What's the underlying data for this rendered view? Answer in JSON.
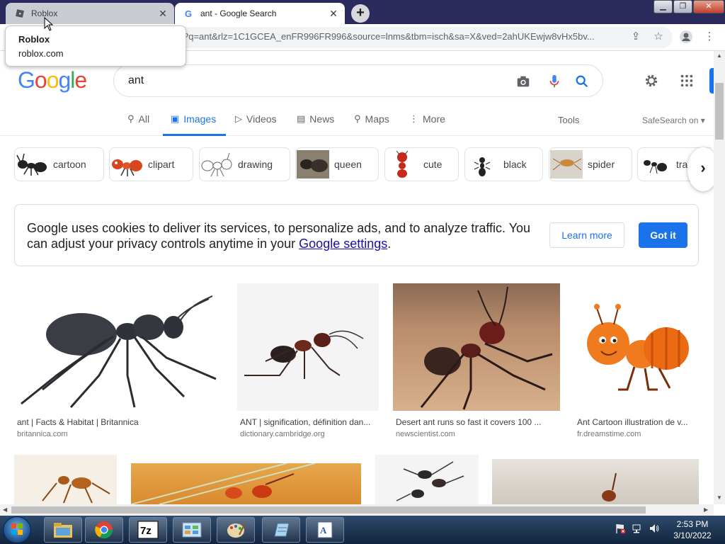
{
  "browser": {
    "tabs": [
      {
        "title": "Roblox",
        "active": false
      },
      {
        "title": "ant - Google Search",
        "active": true
      }
    ],
    "new_tab_label": "+",
    "url": "?q=ant&rlz=1C1GCEA_enFR996FR996&source=lnms&tbm=isch&sa=X&ved=2ahUKEwjw8vHx5bv...",
    "tooltip": {
      "title": "Roblox",
      "domain": "roblox.com"
    }
  },
  "google": {
    "logo_letters": [
      {
        "ch": "G",
        "color": "#4285f4"
      },
      {
        "ch": "o",
        "color": "#ea4335"
      },
      {
        "ch": "o",
        "color": "#fbbc05"
      },
      {
        "ch": "g",
        "color": "#4285f4"
      },
      {
        "ch": "l",
        "color": "#34a853"
      },
      {
        "ch": "e",
        "color": "#ea4335"
      }
    ],
    "query": "ant",
    "nav_tabs": [
      {
        "label": "All",
        "icon": "search-icon",
        "selected": false
      },
      {
        "label": "Images",
        "icon": "image-icon",
        "selected": true
      },
      {
        "label": "Videos",
        "icon": "play-icon",
        "selected": false
      },
      {
        "label": "News",
        "icon": "news-icon",
        "selected": false
      },
      {
        "label": "Maps",
        "icon": "map-pin-icon",
        "selected": false
      },
      {
        "label": "More",
        "icon": "more-vert-icon",
        "selected": false
      }
    ],
    "tools_label": "Tools",
    "safesearch_label": "SafeSearch on",
    "chips": [
      "cartoon",
      "clipart",
      "drawing",
      "queen",
      "cute",
      "black",
      "spider",
      "tra"
    ],
    "cookie": {
      "message": "Google uses cookies to deliver its services, to personalize ads, and to analyze traffic. You can adjust your privacy controls anytime in your ",
      "link": "Google settings",
      "suffix": ".",
      "learn_more": "Learn more",
      "got_it": "Got it"
    },
    "results": [
      {
        "caption": "ant | Facts & Habitat | Britannica",
        "source": "britannica.com"
      },
      {
        "caption": "ANT | signification, définition dan...",
        "source": "dictionary.cambridge.org"
      },
      {
        "caption": "Desert ant runs so fast it covers 100 ...",
        "source": "newscientist.com"
      },
      {
        "caption": "Ant Cartoon illustration de v...",
        "source": "fr.dreamstime.com"
      }
    ]
  },
  "taskbar": {
    "time": "2:53 PM",
    "date": "3/10/2022",
    "items": [
      "explorer-icon",
      "chrome-icon",
      "7zip-icon",
      "control-panel-icon",
      "paint-icon",
      "notepad-icon",
      "wordpad-icon"
    ]
  },
  "colors": {
    "accent": "#1a73e8",
    "link": "#1a0dab",
    "titlebar": "#2b2a5c"
  }
}
